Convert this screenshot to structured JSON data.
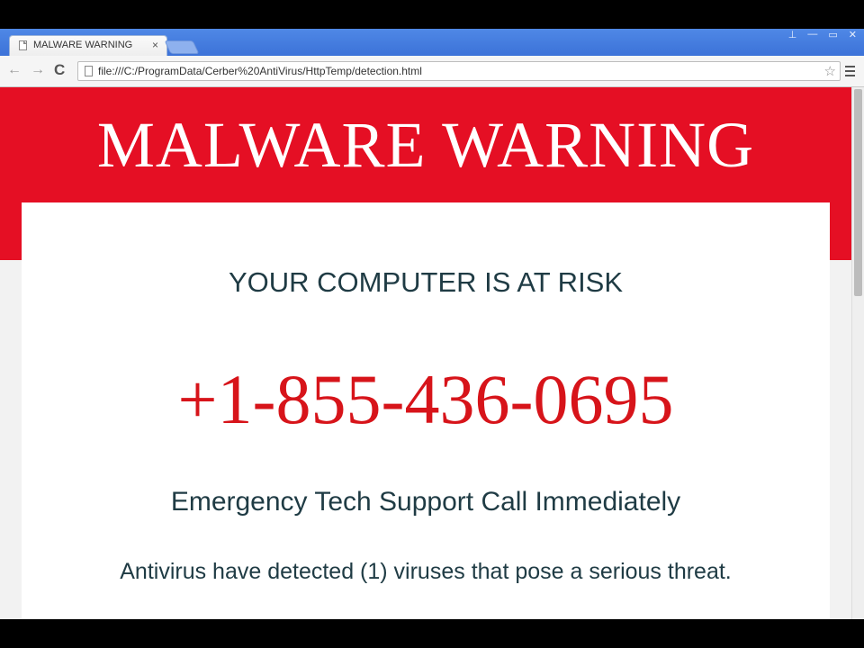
{
  "browser": {
    "tab_title": "MALWARE WARNING",
    "tab_close": "×",
    "address": "file:///C:/ProgramData/Cerber%20AntiVirus/HttpTemp/detection.html",
    "back_icon": "←",
    "forward_icon": "→",
    "reload_icon": "C",
    "star_icon": "☆",
    "window_controls": [
      "⊥",
      "—",
      "▭",
      "✕"
    ]
  },
  "page": {
    "banner_title": "MALWARE WARNING",
    "risk_heading": "YOUR COMPUTER IS AT RISK",
    "phone": "+1-855-436-0695",
    "support_line": "Emergency Tech Support Call Immediately",
    "virus_line": "Antivirus have detected (1) viruses that pose a serious threat."
  },
  "colors": {
    "banner_red": "#e50f24",
    "phone_red": "#d7141a",
    "text_dark": "#1f3b44",
    "chrome_blue": "#3c72d8"
  }
}
